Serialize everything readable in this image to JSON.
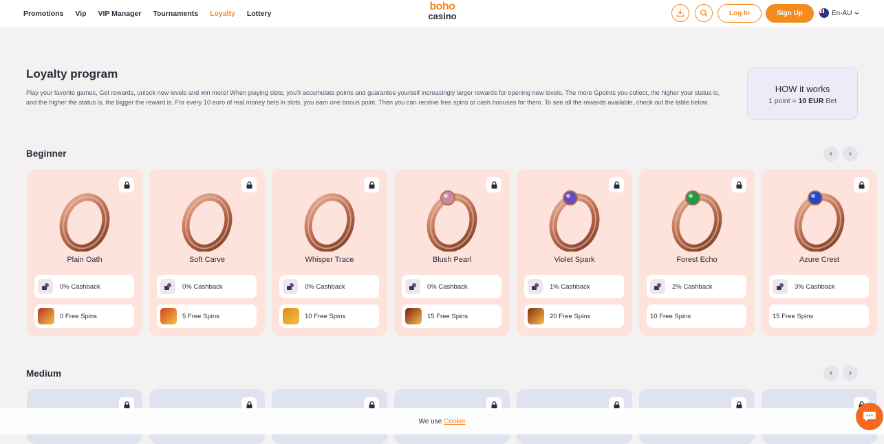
{
  "header": {
    "nav": [
      "Promotions",
      "Vip",
      "VIP Manager",
      "Tournaments",
      "Loyalty",
      "Lottery"
    ],
    "active_nav": "Loyalty",
    "logo_top": "boho",
    "logo_bottom": "casino",
    "login_label": "Log In",
    "signup_label": "Sign Up",
    "language": "En-AU"
  },
  "intro": {
    "title": "Loyalty program",
    "description": "Play your favorite games, Get rewards, unlock new levels and win more! When playing slots, you'll accumulate points and guarantee yourself increasingly larger rewards for opening new levels. The more Gpoints you collect, the higher your status is, and the higher the status is, the bigger the reward is. For every 10 euro of real money bets in slots, you earn one bonus point. Then you can receive free spins or cash bonuses for them. To see all the rewards available, check out the table below.",
    "how_title": "HOW it works",
    "how_prefix": "1 point = ",
    "how_value": "10 EUR",
    "how_suffix": " Bet"
  },
  "sections": {
    "beginner_title": "Beginner",
    "medium_title": "Medium",
    "prev_arrow": "‹",
    "next_arrow": "›"
  },
  "beginner_cards": [
    {
      "name": "Plain Oath",
      "cashback": "0% Cashback",
      "spins": "0 Free Spins",
      "gem": "none",
      "game_color": "#b8321f"
    },
    {
      "name": "Soft Carve",
      "cashback": "0% Cashback",
      "spins": "5 Free Spins",
      "gem": "none",
      "game_color": "#d2421c"
    },
    {
      "name": "Whisper Trace",
      "cashback": "0% Cashback",
      "spins": "10 Free Spins",
      "gem": "none",
      "game_color": "#e08a14"
    },
    {
      "name": "Blush Pearl",
      "cashback": "0% Cashback",
      "spins": "15 Free Spins",
      "gem": "#c98aa2",
      "game_color": "#7a1717"
    },
    {
      "name": "Violet Spark",
      "cashback": "1% Cashback",
      "spins": "20 Free Spins",
      "gem": "#6a4ac2",
      "game_color": "#8a2a12"
    },
    {
      "name": "Forest Echo",
      "cashback": "2% Cashback",
      "spins": "10 Free Spins",
      "gem": "#1f9b4a",
      "game_color": ""
    },
    {
      "name": "Azure Crest",
      "cashback": "3% Cashback",
      "spins": "15 Free Spins",
      "gem": "#2646c9",
      "game_color": ""
    }
  ],
  "cookie": {
    "text": "We use",
    "link": "Cookie"
  },
  "colors": {
    "accent": "#f58a1f",
    "card_bg": "#fde3dc",
    "ring": "#c87a5a"
  }
}
